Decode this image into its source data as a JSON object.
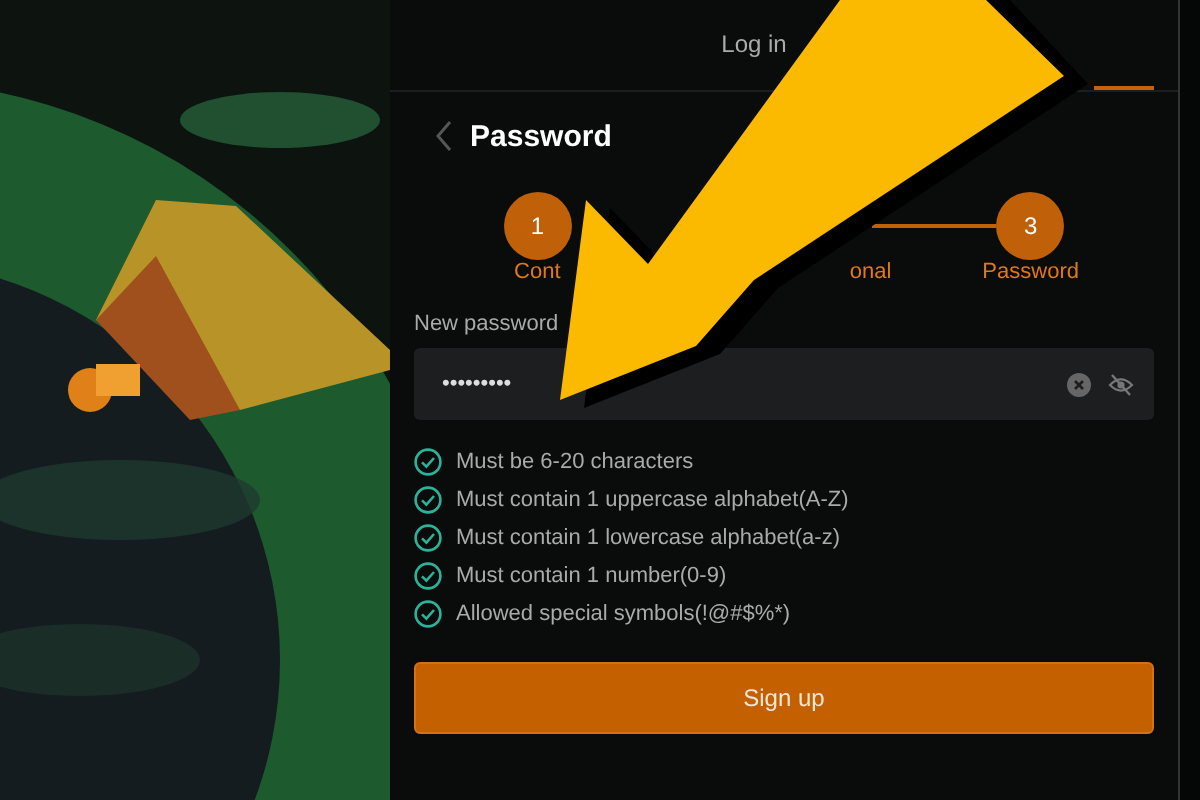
{
  "tabs": [
    {
      "label": "Log in",
      "selected": false
    },
    {
      "selected": true
    }
  ],
  "title": "Password",
  "steps": [
    {
      "number": "1",
      "label": "Cont"
    },
    {
      "label": "onal"
    },
    {
      "number": "3",
      "label": "Password"
    }
  ],
  "field": {
    "label": "New password",
    "value": "•••••••••"
  },
  "rules": [
    {
      "text": "Must be 6-20 characters",
      "checked": true
    },
    {
      "text": "Must contain 1 uppercase alphabet(A-Z)",
      "checked": true
    },
    {
      "text": "Must contain 1 lowercase alphabet(a-z)",
      "checked": true
    },
    {
      "text": "Must contain 1 number(0-9)",
      "checked": true
    },
    {
      "text": "Allowed special symbols(!@#$%*)",
      "checked": true
    }
  ],
  "button": "Sign up"
}
